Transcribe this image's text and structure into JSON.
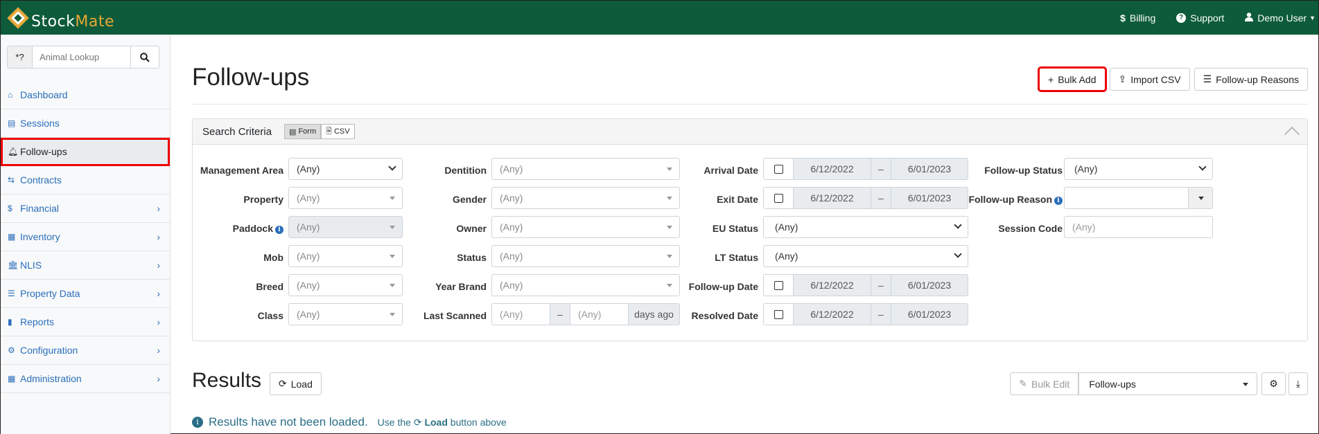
{
  "brand": {
    "name_a": "Stock",
    "name_b": "Mate"
  },
  "nav": [
    {
      "icon": "$",
      "label": "Billing"
    },
    {
      "icon": "?",
      "label": "Support"
    },
    {
      "icon": "user",
      "label": "Demo User"
    }
  ],
  "sidebar": {
    "lookup_prefix": "*?",
    "lookup_placeholder": "Animal Lookup",
    "items": [
      {
        "label": "Dashboard",
        "icon": "home-icon"
      },
      {
        "label": "Sessions",
        "icon": "table-icon"
      },
      {
        "label": "Follow-ups",
        "icon": "bell-icon"
      },
      {
        "label": "Contracts",
        "icon": "handshake-icon"
      },
      {
        "label": "Financial",
        "icon": "dollar-icon"
      },
      {
        "label": "Inventory",
        "icon": "boxes-icon"
      },
      {
        "label": "NLIS",
        "icon": "building-icon"
      },
      {
        "label": "Property Data",
        "icon": "sliders-icon"
      },
      {
        "label": "Reports",
        "icon": "bar-chart-icon"
      },
      {
        "label": "Configuration",
        "icon": "gear-icon"
      },
      {
        "label": "Administration",
        "icon": "org-icon"
      }
    ]
  },
  "page": {
    "title": "Follow-ups",
    "bulk_add": "Bulk Add",
    "import_csv": "Import CSV",
    "reasons": "Follow-up Reasons"
  },
  "search": {
    "title": "Search Criteria",
    "form_tab": "Form",
    "csv_tab": "CSV",
    "any": "(Any)",
    "dash": "–",
    "date_from": "6/12/2022",
    "date_to": "6/01/2023",
    "days_ago": "days ago",
    "labels": {
      "management_area": "Management Area",
      "property": "Property",
      "paddock": "Paddock",
      "mob": "Mob",
      "breed": "Breed",
      "class": "Class",
      "dentition": "Dentition",
      "gender": "Gender",
      "owner": "Owner",
      "status": "Status",
      "year_brand": "Year Brand",
      "last_scanned": "Last Scanned",
      "arrival_date": "Arrival Date",
      "exit_date": "Exit Date",
      "eu_status": "EU Status",
      "lt_status": "LT Status",
      "followup_date": "Follow-up Date",
      "resolved_date": "Resolved Date",
      "followup_status": "Follow-up Status",
      "followup_reason": "Follow-up Reason",
      "session_code": "Session Code"
    }
  },
  "results": {
    "title": "Results",
    "load": "Load",
    "bulk_edit": "Bulk Edit",
    "view_select": "Follow-ups",
    "msg": "Results have not been loaded.",
    "hint_a": "Use the",
    "hint_b": "Load",
    "hint_c": "button above"
  }
}
